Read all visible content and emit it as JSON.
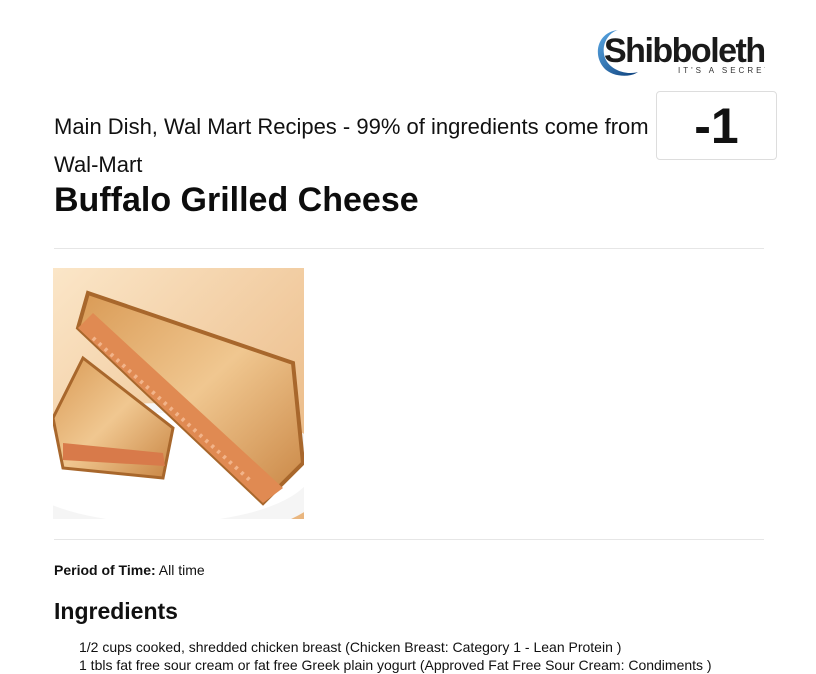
{
  "logo": {
    "name": "Shibboleth",
    "tagline": "IT'S A SECRET"
  },
  "recipe": {
    "category": "Main Dish, Wal Mart Recipes - 99% of ingredients come from Wal-Mart",
    "score": "-1",
    "title": "Buffalo Grilled Cheese",
    "image_alt": "Buffalo grilled cheese sandwich on a white plate"
  },
  "period": {
    "label": "Period of Time:",
    "value": "All time"
  },
  "ingredients": {
    "heading": "Ingredients",
    "items": [
      "1/2 cups cooked, shredded chicken breast (Chicken Breast: Category 1 - Lean Protein )",
      "1 tbls fat free sour cream or fat free Greek plain yogurt (Approved Fat Free Sour Cream: Condiments )"
    ]
  },
  "colors": {
    "logo_blue": "#1f5fa8",
    "logo_dark": "#1a1a1a",
    "rule": "#e6e6e6"
  }
}
